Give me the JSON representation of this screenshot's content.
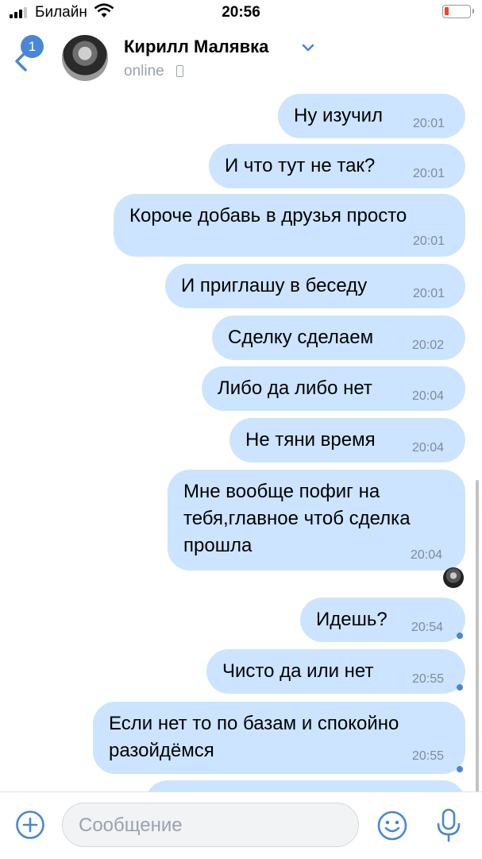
{
  "status_bar": {
    "carrier": "Билайн",
    "time": "20:56",
    "battery_color": "#ff3b30"
  },
  "header": {
    "back_badge": "1",
    "contact_name": "Кирилл Малявка",
    "presence": "online",
    "icons": [
      "back-chevron-icon",
      "chevron-down-icon",
      "mobile-phone-icon"
    ]
  },
  "messages": [
    {
      "text": "Ну изучил",
      "time": "20:01"
    },
    {
      "text": "И что тут не так?",
      "time": "20:01"
    },
    {
      "text": "Короче добавь в друзья просто",
      "time": "20:01"
    },
    {
      "text": "И приглашу в беседу",
      "time": "20:01"
    },
    {
      "text": "Сделку сделаем",
      "time": "20:02"
    },
    {
      "text": "Либо да либо нет",
      "time": "20:04"
    },
    {
      "text": "Не тяни время",
      "time": "20:04"
    },
    {
      "text": "Мне вообще пофиг на\nтебя,главное чтоб сделка\nпрошла",
      "time": "20:04"
    },
    {
      "text": "Идешь?",
      "time": "20:54"
    },
    {
      "text": "Чисто да или нет",
      "time": "20:55"
    },
    {
      "text": "Если нет то по базам и спокойно\nразойдёмся",
      "time": "20:55"
    }
  ],
  "composer": {
    "placeholder": "Сообщение",
    "icons": [
      "attach-plus-icon",
      "emoji-icon",
      "microphone-icon"
    ]
  },
  "colors": {
    "accent": "#4a86d6",
    "outgoing_bubble": "#cce4ff",
    "muted_text": "#99a2ad"
  }
}
